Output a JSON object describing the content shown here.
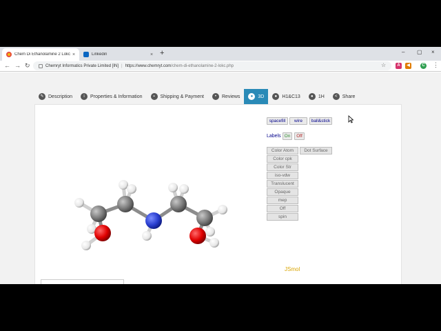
{
  "browser": {
    "tabs": [
      {
        "title": "Chem Di Ethanolamine 2 Lokc - Ch",
        "close": "×",
        "favicon_color": "#f2b90f"
      },
      {
        "title": "Linkedin",
        "close": "×",
        "favicon_color": "#0a66c2"
      }
    ],
    "new_tab": "+",
    "window_controls": {
      "minimize": "–",
      "maximize": "▢",
      "close": "×"
    },
    "nav": {
      "back": "←",
      "forward": "→",
      "reload": "↻"
    },
    "address": {
      "site_name": "Chemryt Informatics Private Limited [IN]",
      "separator": "|",
      "url_host": "https://www.chemryt.com",
      "url_path": "/chem-di-ethanolamine-2-lokc.php"
    },
    "bookmark_star": "☆",
    "extensions": [
      {
        "name": "a-extension-icon",
        "label": "A",
        "color": "#d6336c"
      },
      {
        "name": "megaphone-extension-icon",
        "label": "◀",
        "color": "#e07b00"
      },
      {
        "name": "chrome-extension-icon",
        "label": "C",
        "color": "#2e9e4f"
      }
    ],
    "menu": "⋮"
  },
  "page": {
    "tabs": [
      {
        "label": "Description",
        "icon": "pencil-icon",
        "glyph": "✎"
      },
      {
        "label": "Properties & Information",
        "icon": "info-icon",
        "glyph": "i"
      },
      {
        "label": "Shipping & Payment",
        "icon": "truck-icon",
        "glyph": "▪"
      },
      {
        "label": "Reviews",
        "icon": "chat-icon",
        "glyph": "•"
      },
      {
        "label": "3D",
        "icon": "user-icon",
        "glyph": "●",
        "active": true
      },
      {
        "label": "H1&C13",
        "icon": "user-icon",
        "glyph": "●"
      },
      {
        "label": "1H",
        "icon": "user-icon",
        "glyph": "●"
      },
      {
        "label": "Share",
        "icon": "share-icon",
        "glyph": "<"
      }
    ],
    "viewer": {
      "render_buttons": [
        "spacefill",
        "wire",
        "ball&stick"
      ],
      "labels_label": "Labels",
      "labels_on": "On",
      "labels_off": "Off",
      "color_buttons": [
        "Color Atom",
        "Color cpk",
        "Color Str",
        "iso-vdw",
        "Translucent",
        "Opaque",
        "mep",
        "Off",
        "spin"
      ],
      "dot_surface": "Dot Surface",
      "jsmol_label": "JSmol"
    }
  },
  "colors": {
    "accent": "#2a8ab7",
    "carbon": "#8c8c8c",
    "hydrogen": "#ffffff",
    "nitrogen": "#2a3fd0",
    "oxygen": "#e00000"
  }
}
